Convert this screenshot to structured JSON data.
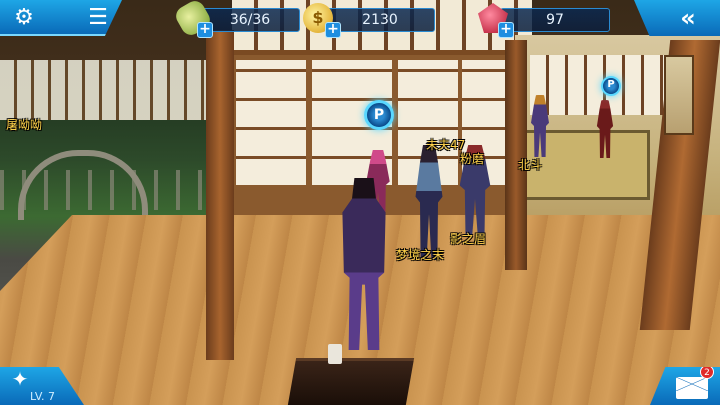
{
  "hud": {
    "energy": "36/36",
    "gold": "2130",
    "gems": "97",
    "level": "LV. 7",
    "mail_badge": "2",
    "gold_icon_glyph": "$",
    "plus": "+"
  },
  "icons": {
    "settings": "gear-icon",
    "menu": "menu-icon",
    "back": "back-arrow-icon",
    "energy": "energy-battery-icon",
    "gold": "gold-coin-icon",
    "gem": "red-gem-icon",
    "avatar": "fox-avatar-icon",
    "mail": "mail-icon"
  },
  "colors": {
    "hud_blue": "#1ea6e6",
    "name_yellow": "#ffd24a",
    "marker_cyan": "#5ad8ff"
  },
  "players": {
    "p_left": "屠呦呦",
    "p_hero": "梦境之末",
    "p_shadow": "影之眉",
    "p_fen": "粉磨",
    "p_wei": "未夫47",
    "p_bei": "北斗"
  },
  "markers": {
    "m1": "P",
    "m2": "P"
  }
}
